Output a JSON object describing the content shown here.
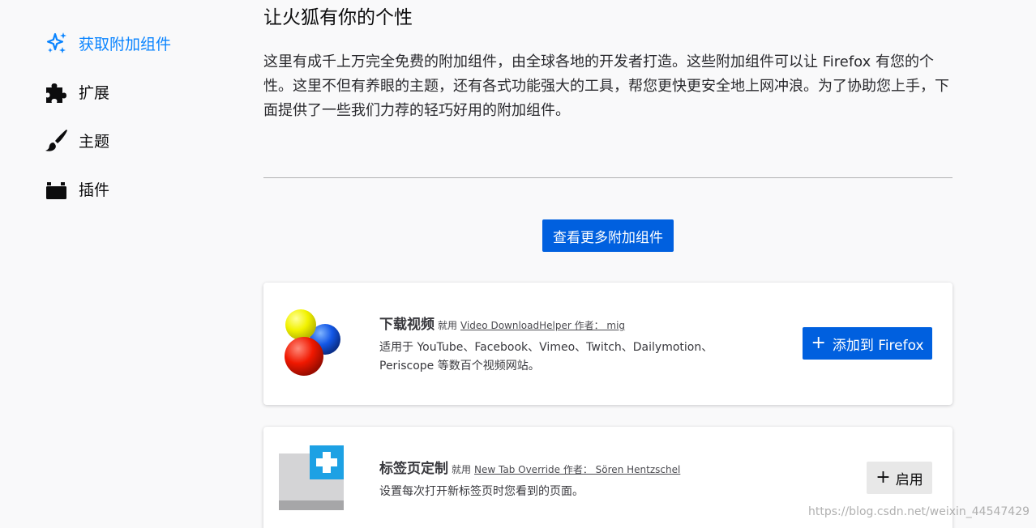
{
  "sidebar": {
    "items": [
      {
        "label": "获取附加组件",
        "icon": "sparkle-icon",
        "active": true
      },
      {
        "label": "扩展",
        "icon": "puzzle-piece-icon",
        "active": false
      },
      {
        "label": "主题",
        "icon": "paintbrush-icon",
        "active": false
      },
      {
        "label": "插件",
        "icon": "plugin-block-icon",
        "active": false
      }
    ]
  },
  "main": {
    "heading": "让火狐有你的个性",
    "intro": "这里有成千上万完全免费的附加组件，由全球各地的开发者打造。这些附加组件可以让 Firefox 有您的个性。这里不但有养眼的主题，还有各式功能强大的工具，帮您更快更安全地上网冲浪。为了协助您上手，下面提供了一些我们力荐的轻巧好用的附加组件。",
    "more_button": "查看更多附加组件"
  },
  "cards": [
    {
      "name": "下载视频",
      "rec_label": "就用",
      "link": "Video DownloadHelper 作者： mig",
      "desc_line1": "适用于 YouTube、Facebook、Vimeo、Twitch、Dailymotion、",
      "desc_line2": "Periscope 等数百个视频网站。",
      "button_plus": "+",
      "button": "添加到 Firefox",
      "icon": "video-downloadhelper-balls-icon"
    },
    {
      "name": "标签页定制",
      "rec_label": "就用",
      "link": "New Tab Override 作者： Sören Hentzschel",
      "desc_line1": "设置每次打开新标签页时您看到的页面。",
      "button_plus": "+",
      "button": "启用",
      "icon": "new-tab-override-icon"
    }
  ],
  "watermark": "https://blog.csdn.net/weixin_44547429",
  "colors": {
    "accent": "#0060df",
    "active_nav": "#0a84ff",
    "background": "#f9f9fa"
  }
}
